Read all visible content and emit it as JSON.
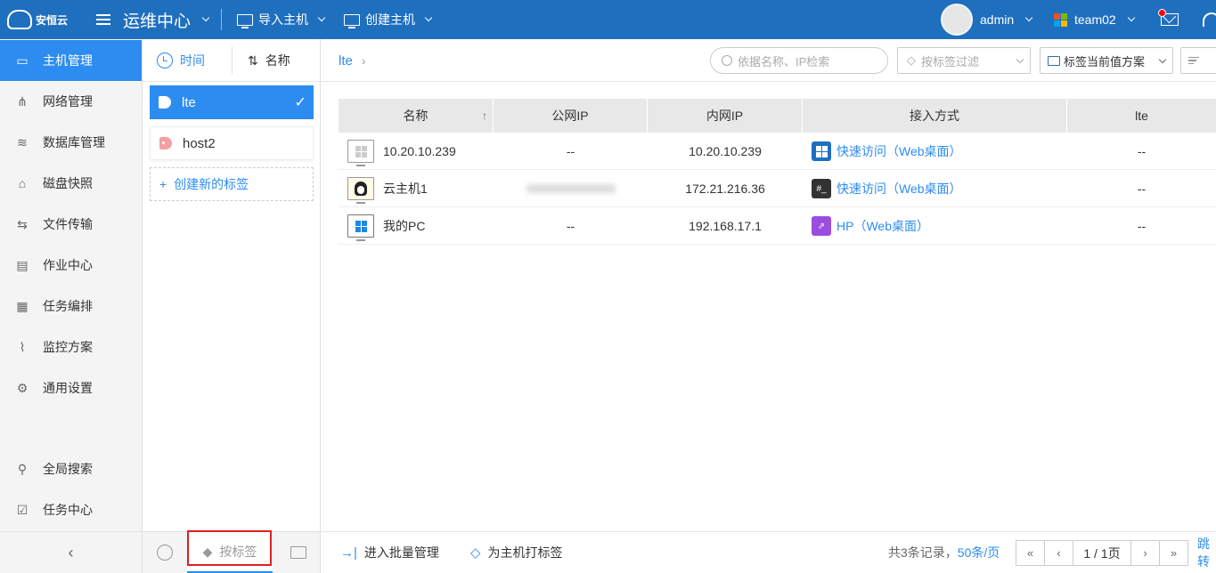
{
  "topbar": {
    "logo_text": "安恒云",
    "module_title": "运维中心",
    "import_label": "导入主机",
    "create_label": "创建主机",
    "user_name": "admin",
    "team_name": "team02"
  },
  "sidebar": {
    "items": [
      {
        "label": "主机管理",
        "icon": "monitor-icon",
        "active": true
      },
      {
        "label": "网络管理",
        "icon": "network-icon"
      },
      {
        "label": "数据库管理",
        "icon": "database-icon"
      },
      {
        "label": "磁盘快照",
        "icon": "disk-icon"
      },
      {
        "label": "文件传输",
        "icon": "file-transfer-icon"
      },
      {
        "label": "作业中心",
        "icon": "clipboard-icon"
      },
      {
        "label": "任务编排",
        "icon": "task-icon"
      },
      {
        "label": "监控方案",
        "icon": "chart-icon"
      },
      {
        "label": "通用设置",
        "icon": "gear-icon"
      }
    ],
    "global_search": "全局搜索",
    "task_center": "任务中心",
    "collapse_icon": "‹"
  },
  "tagpanel": {
    "sort_time": "时间",
    "sort_name": "名称",
    "tags": [
      {
        "label": "lte",
        "selected": true,
        "color": "#2d8cf0"
      },
      {
        "label": "host2",
        "selected": false,
        "color": "#f08080"
      }
    ],
    "new_tag": "创建新的标签",
    "by_tag": "按标签"
  },
  "main": {
    "breadcrumb": "lte",
    "search_placeholder": "依据名称、IP检索",
    "tag_filter_placeholder": "按标签过滤",
    "scheme_label": "标签当前值方案"
  },
  "table": {
    "headers": [
      "名称",
      "公网IP",
      "内网IP",
      "接入方式",
      "lte"
    ],
    "sort_arrow": "↑",
    "rows": [
      {
        "os": "windows-gray",
        "name": "10.20.10.239",
        "public_ip": "--",
        "private_ip": "10.20.10.239",
        "access": "快速访问（Web桌面）",
        "access_icon": "windows-icon",
        "access_color": "#1f6fbf",
        "lte": "--"
      },
      {
        "os": "linux",
        "name": "云主机1",
        "public_ip": "",
        "private_ip": "172.21.216.36",
        "access": "快速访问（Web桌面）",
        "access_icon": "terminal-icon",
        "access_color": "#333333",
        "lte": "--"
      },
      {
        "os": "windows-blue",
        "name": "我的PC",
        "public_ip": "--",
        "private_ip": "192.168.17.1",
        "access": "HP（Web桌面）",
        "access_icon": "remote-desktop-icon",
        "access_color": "#9b4de0",
        "lte": "--"
      }
    ]
  },
  "footer": {
    "batch_label": "进入批量管理",
    "tag_host_label": "为主机打标签",
    "total_text": "共3条记录，",
    "per_page": "50条/页",
    "page_indicator": "1 / 1页",
    "jump_label": "跳转"
  }
}
